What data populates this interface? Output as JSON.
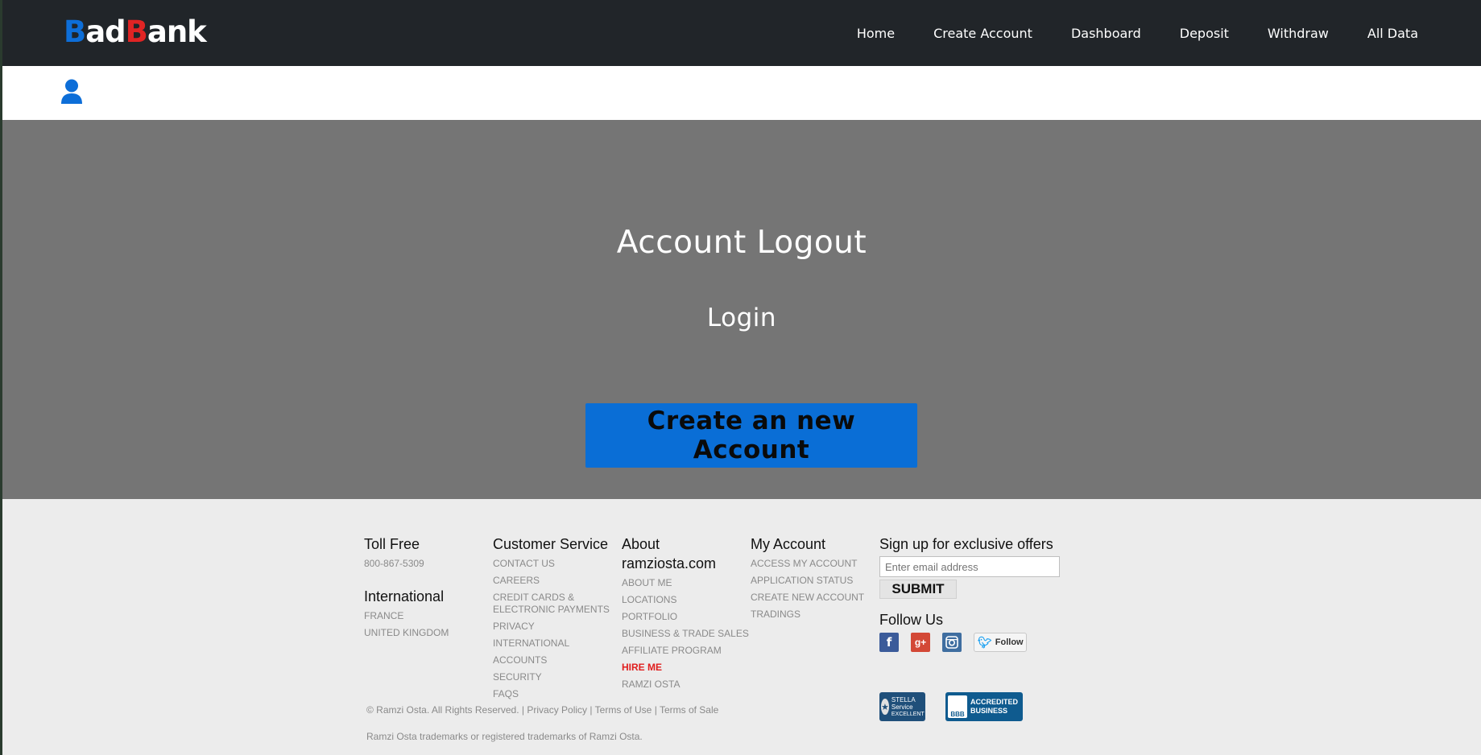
{
  "brand": {
    "b": "B",
    "ad": "ad",
    "b2": "B",
    "ank": "ank",
    "colors": {
      "blue": "#0d6ed8",
      "red": "#e02424"
    }
  },
  "nav": {
    "links": [
      "Home",
      "Create Account",
      "Dashboard",
      "Deposit",
      "Withdraw",
      "All Data"
    ]
  },
  "userbar": {
    "icon": "user-icon"
  },
  "main": {
    "title": "Account Logout",
    "subtitle": "Login",
    "cta_label": "Create an new Account"
  },
  "footer": {
    "toll_free": {
      "heading": "Toll Free",
      "phone": "800-867-5309"
    },
    "international": {
      "heading": "International",
      "items": [
        "FRANCE",
        "UNITED KINGDOM"
      ]
    },
    "customer_service": {
      "heading": "Customer Service",
      "items": [
        "CONTACT US",
        "CAREERS",
        "CREDIT CARDS &",
        "ELECTRONIC PAYMENTS",
        "PRIVACY",
        "INTERNATIONAL ACCOUNTS",
        "SECURITY",
        "FAQS"
      ]
    },
    "about": {
      "heading_line1": "About",
      "heading_line2": "ramziosta.com",
      "items": [
        "ABOUT ME",
        "LOCATIONS",
        "PORTFOLIO",
        "BUSINESS & TRADE SALES",
        "AFFILIATE PROGRAM",
        "HIRE ME",
        "RAMZI OSTA"
      ]
    },
    "my_account": {
      "heading": "My Account",
      "items": [
        "ACCESS MY ACCOUNT",
        "APPLICATION STATUS",
        "CREATE NEW ACCOUNT",
        "TRADINGS"
      ]
    },
    "signup": {
      "heading": "Sign up for exclusive offers",
      "email_placeholder": "Enter email address",
      "submit_label": "SUBMIT"
    },
    "follow": {
      "heading": "Follow Us",
      "twitter_label": "Follow"
    },
    "badges": {
      "stella": {
        "line1": "STELLA",
        "line2": "Service",
        "line3": "EXCELLENT"
      },
      "bbb": {
        "mark": "BBB",
        "line1": "ACCREDITED",
        "line2": "BUSINESS"
      }
    },
    "legal": {
      "copyright": "© Ramzi Osta. All Rights Reserved. |",
      "privacy": "Privacy Policy",
      "sep1": "|",
      "terms_use": "Terms of Use",
      "sep2": "|",
      "terms_sale": "Terms of Sale",
      "trademark": "Ramzi Osta trademarks or registered trademarks of Ramzi Osta."
    }
  }
}
